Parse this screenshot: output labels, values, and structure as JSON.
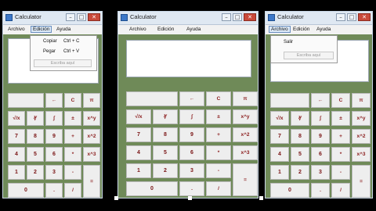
{
  "windows": [
    {
      "title": "Calculator",
      "menus": [
        "Archivo",
        "Edición",
        "Ayuda"
      ],
      "open_menu": 1,
      "dropdown": {
        "items": [
          {
            "label": "Copiar",
            "shortcut": "Ctrl + C"
          },
          {
            "label": "Pegar",
            "shortcut": "Ctrl + V"
          }
        ],
        "input_placeholder": "Escriba aquí"
      }
    },
    {
      "title": "Calculator",
      "menus": [
        "Archivo",
        "Edición",
        "Ayuda"
      ],
      "open_menu": -1
    },
    {
      "title": "Calculator",
      "menus": [
        "Archivo",
        "Edición",
        "Ayuda"
      ],
      "open_menu": 0,
      "dropdown": {
        "items": [
          {
            "label": "Salir",
            "shortcut": ""
          }
        ],
        "input_placeholder": "Escriba aquí"
      }
    }
  ],
  "window_buttons": {
    "minimize": "–",
    "maximize": "□",
    "close": "✕"
  },
  "keypad": {
    "row0": [
      "",
      "←",
      "C",
      "π"
    ],
    "row1": [
      "√/x",
      "∛",
      "∫",
      "±",
      "x^y"
    ],
    "row2": [
      "7",
      "8",
      "9",
      "+",
      "x^2"
    ],
    "row3": [
      "4",
      "5",
      "6",
      "*",
      "x^3"
    ],
    "row4": [
      "1",
      "2",
      "3",
      "-"
    ],
    "row5": [
      "0",
      ".",
      "/"
    ],
    "equals": "="
  }
}
